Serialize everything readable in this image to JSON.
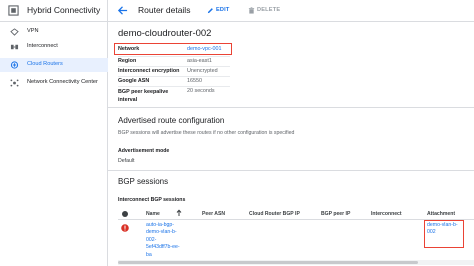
{
  "sidebar": {
    "title": "Hybrid Connectivity",
    "items": [
      {
        "label": "VPN",
        "icon": "vpn-icon"
      },
      {
        "label": "Interconnect",
        "icon": "interconnect-icon"
      },
      {
        "label": "Cloud Routers",
        "icon": "cloud-router-icon",
        "active": true
      },
      {
        "label": "Network Connectivity Center",
        "icon": "network-connectivity-icon"
      }
    ]
  },
  "topbar": {
    "title": "Router details",
    "edit_label": "EDIT",
    "delete_label": "DELETE"
  },
  "router": {
    "name": "demo-cloudrouter-002",
    "details": [
      {
        "key": "Network",
        "value": "demo-vpc-001",
        "link": true
      },
      {
        "key": "Region",
        "value": "asia-east1"
      },
      {
        "key": "Interconnect encryption",
        "value": "Unencrypted"
      },
      {
        "key": "Google ASN",
        "value": "16550"
      },
      {
        "key": "BGP peer keepalive interval",
        "value": "20 seconds"
      }
    ]
  },
  "advertised": {
    "title": "Advertised route configuration",
    "description": "BGP sessions will advertise these routes if no other configuration is specified",
    "mode_label": "Advertisement mode",
    "mode_value": "Default"
  },
  "bgp": {
    "title": "BGP sessions",
    "table_title": "Interconnect BGP sessions",
    "columns": [
      "Name",
      "Peer ASN",
      "Cloud Router BGP IP",
      "BGP peer IP",
      "Interconnect",
      "Attachment"
    ],
    "rows": [
      {
        "status": "error",
        "name": "auto-ia-bgp-demo-vlan-b-002-5ef43dff7b-ee-ba",
        "name_lines": [
          "auto-ia-bgp-",
          "demo-vlan-b-",
          "002-",
          "5ef43dff7b-ee-",
          "ba"
        ],
        "peer_asn": "",
        "router_ip": "",
        "peer_ip": "",
        "interconnect": "",
        "attachment_lines": [
          "demo-vlan-b-",
          "002"
        ]
      }
    ]
  },
  "colors": {
    "accent": "#1a73e8",
    "highlight": "#ea4335",
    "active_bg": "#e8f0fe"
  }
}
